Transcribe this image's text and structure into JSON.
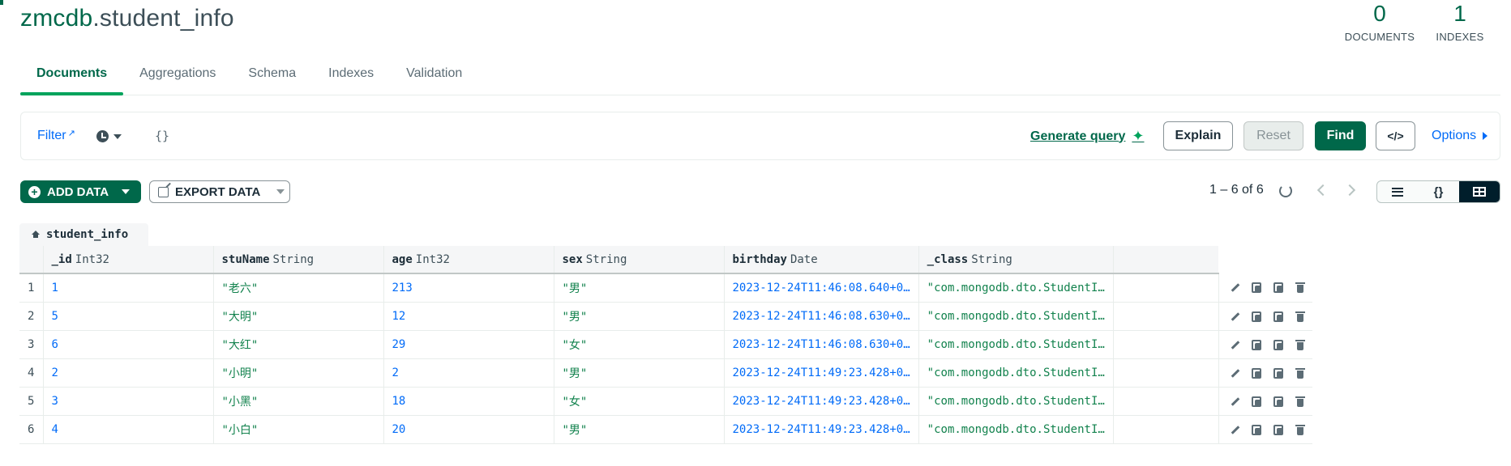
{
  "header": {
    "db_name": "zmcdb",
    "coll_name": ".student_info",
    "stats": [
      {
        "value": "0",
        "label": "DOCUMENTS"
      },
      {
        "value": "1",
        "label": "INDEXES"
      }
    ]
  },
  "tabs": [
    "Documents",
    "Aggregations",
    "Schema",
    "Indexes",
    "Validation"
  ],
  "active_tab": "Documents",
  "querybar": {
    "filter_label": "Filter",
    "filter_value": "{}",
    "generate_query": "Generate query",
    "explain": "Explain",
    "reset": "Reset",
    "find": "Find",
    "options": "Options"
  },
  "actions": {
    "add_data": "ADD DATA",
    "export_data": "EXPORT DATA",
    "pagination": "1 – 6 of 6"
  },
  "table": {
    "collection_tab": "student_info",
    "columns": [
      {
        "name": "_id",
        "type": "Int32"
      },
      {
        "name": "stuName",
        "type": "String"
      },
      {
        "name": "age",
        "type": "Int32"
      },
      {
        "name": "sex",
        "type": "String"
      },
      {
        "name": "birthday",
        "type": "Date"
      },
      {
        "name": "_class",
        "type": "String"
      }
    ],
    "rows": [
      {
        "n": "1",
        "_id": "1",
        "stuName": "\"老六\"",
        "age": "213",
        "sex": "\"男\"",
        "birthday": "2023-12-24T11:46:08.640+0…",
        "_class": "\"com.mongodb.dto.StudentI…"
      },
      {
        "n": "2",
        "_id": "5",
        "stuName": "\"大明\"",
        "age": "12",
        "sex": "\"男\"",
        "birthday": "2023-12-24T11:46:08.630+0…",
        "_class": "\"com.mongodb.dto.StudentI…"
      },
      {
        "n": "3",
        "_id": "6",
        "stuName": "\"大红\"",
        "age": "29",
        "sex": "\"女\"",
        "birthday": "2023-12-24T11:46:08.630+0…",
        "_class": "\"com.mongodb.dto.StudentI…"
      },
      {
        "n": "4",
        "_id": "2",
        "stuName": "\"小明\"",
        "age": "2",
        "sex": "\"男\"",
        "birthday": "2023-12-24T11:49:23.428+0…",
        "_class": "\"com.mongodb.dto.StudentI…"
      },
      {
        "n": "5",
        "_id": "3",
        "stuName": "\"小黑\"",
        "age": "18",
        "sex": "\"女\"",
        "birthday": "2023-12-24T11:49:23.428+0…",
        "_class": "\"com.mongodb.dto.StudentI…"
      },
      {
        "n": "6",
        "_id": "4",
        "stuName": "\"小白\"",
        "age": "20",
        "sex": "\"男\"",
        "birthday": "2023-12-24T11:49:23.428+0…",
        "_class": "\"com.mongodb.dto.StudentI…"
      }
    ]
  },
  "colors": {
    "brand_green": "#00684a",
    "link_blue": "#016bf8",
    "string_green": "#12824d"
  }
}
